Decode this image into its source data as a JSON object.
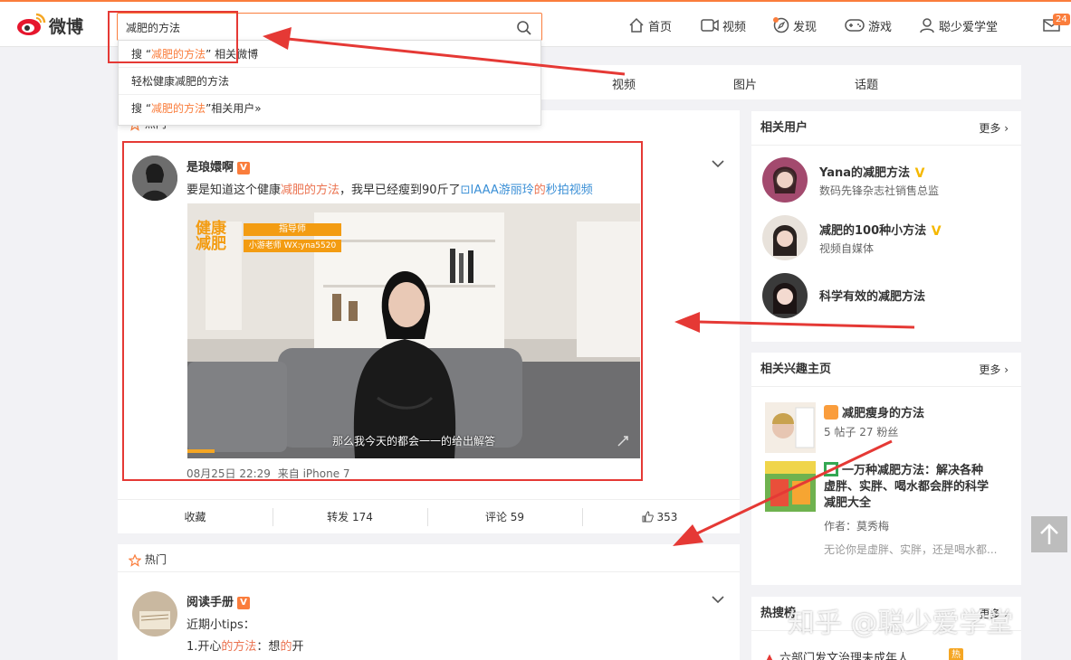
{
  "header": {
    "logo_text": "微博",
    "search_value": "减肥的方法",
    "nav": [
      {
        "label": "首页",
        "icon": "home-icon"
      },
      {
        "label": "视频",
        "icon": "video-icon"
      },
      {
        "label": "发现",
        "icon": "compass-icon"
      },
      {
        "label": "游戏",
        "icon": "gamepad-icon"
      },
      {
        "label": "聪少爱学堂",
        "icon": "user-icon"
      }
    ],
    "mail_count": "24"
  },
  "search_dropdown": {
    "items": [
      {
        "prefix": "搜 “",
        "keyword": "减肥的方法",
        "suffix": "” 相关微博"
      },
      {
        "prefix": "",
        "keyword": "",
        "suffix": "轻松健康减肥的方法"
      },
      {
        "prefix": "搜 “",
        "keyword": "减肥的方法",
        "suffix": "”相关用户»"
      }
    ]
  },
  "result_tabs": [
    "视频",
    "图片",
    "话题"
  ],
  "post1": {
    "section_label": "热门",
    "author": "是琅嬛啊",
    "text_before": "要是知道这个健康",
    "text_keyword": "减肥的方法",
    "text_after": "，我早已经瘦到90斤了",
    "link_text": "IAAA游丽玲",
    "text_de": "的",
    "link_video": "秒拍视频",
    "video_banner_title": "健康减肥",
    "video_banner_role": "指导师",
    "video_banner_contact": "小游老师 WX:yna5520",
    "video_subtitle": "那么我今天的都会一一的给出解答",
    "time": "08月25日 22:29",
    "source": "来自 iPhone 7",
    "actions": {
      "favorite": "收藏",
      "repost": "转发 174",
      "comment": "评论 59",
      "like": "353"
    }
  },
  "post2": {
    "section_label": "热门",
    "author": "阅读手册",
    "line1": "近期小tips：",
    "line2_a": "1.开心",
    "line2_keyword": "的方法",
    "line2_b": "：想",
    "line2_keyword2": "的",
    "line2_c": "开"
  },
  "related_users": {
    "title": "相关用户",
    "more": "更多",
    "items": [
      {
        "name": "Yana的减肥方法",
        "desc": "数码先锋杂志社销售总监",
        "verified": true
      },
      {
        "name": "减肥的100种小方法",
        "desc": "视频自媒体",
        "verified": true
      },
      {
        "name": "科学有效的减肥方法",
        "desc": "",
        "verified": false
      }
    ]
  },
  "interest_pages": {
    "title": "相关兴趣主页",
    "more": "更多",
    "items": [
      {
        "name": "减肥瘦身的方法",
        "stats": "5 帖子 27 粉丝"
      },
      {
        "name": "一万种减肥方法：解决各种虚胖、实胖、喝水都会胖的科学减肥大全",
        "name_lines": [
          "一万种减肥方法：解决各种",
          "虚胖、实胖、喝水都会胖的科学",
          "减肥大全"
        ],
        "author": "作者：莫秀梅",
        "excerpt": "无论你是虚胖、实胖，还是喝水都..."
      }
    ]
  },
  "hot_search": {
    "title": "热搜榜",
    "more": "更多",
    "first_item": "六部门发文治理未成年人",
    "first_badge": "热"
  },
  "watermark": "知乎 @聪少爱学堂"
}
